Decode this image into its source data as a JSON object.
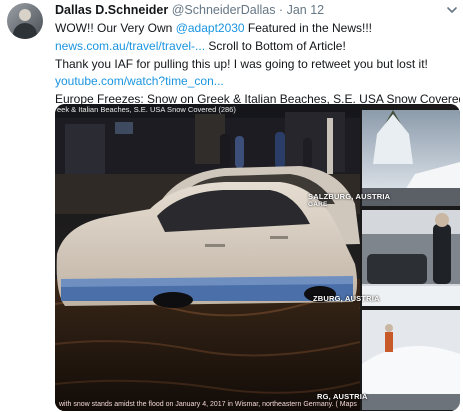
{
  "tweet": {
    "author_name": "Dallas D.Schneider",
    "handle": "@SchneiderDallas",
    "separator": " · ",
    "date": "Jan 12",
    "line1_pre": "WOW!! Our Very Own ",
    "line1_mention": "@adapt2030",
    "line1_post": " Featured in the News!!!",
    "line2_link": "news.com.au/travel/travel-...",
    "line2_post": " Scroll to Bottom of Article!",
    "line3": "Thank you IAF for pulling this up! I was going to retweet you but lost it!",
    "line4_link": "youtube.com/watch?time_con...",
    "line5": "Europe Freezes: Snow on Greek & Italian Beaches, S.E. USA Snow Covered",
    "emoji_icon": "cowboy-face-icon"
  },
  "media": {
    "caption_top": "eek & Italian Beaches, S.E. USA Snow Covered (286)",
    "caption_bottom": "with snow stands amidst the flood on January 4, 2017 in Wismar, northeastern Germany. ( Maps",
    "thumb1_label": "SALZBURG, AUSTRIA",
    "thumb1_sublabel": "GARE",
    "thumb2_label": "ZBURG, AUSTRIA",
    "thumb3_label": "RG, AUSTRIA"
  },
  "colors": {
    "link": "#1b95e0",
    "text": "#14171a",
    "muted": "#657786"
  }
}
